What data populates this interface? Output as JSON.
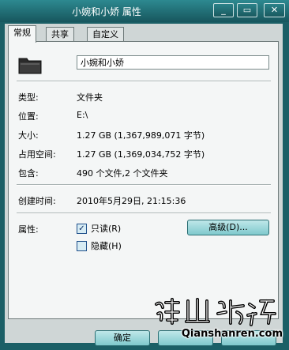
{
  "window": {
    "title": "小婉和小娇 属性",
    "buttons": {
      "minimize": "_",
      "maximize": "▭",
      "close": "✕"
    }
  },
  "tabs": [
    {
      "label": "常规",
      "active": true
    },
    {
      "label": "共享",
      "active": false
    },
    {
      "label": "自定义",
      "active": false
    }
  ],
  "general": {
    "folder_icon": "folder-icon",
    "name_value": "小婉和小娇",
    "rows": [
      {
        "label": "类型:",
        "value": "文件夹"
      },
      {
        "label": "位置:",
        "value": "E:\\"
      },
      {
        "label": "大小:",
        "value": "1.27 GB (1,367,989,071 字节)"
      },
      {
        "label": "占用空间:",
        "value": "1.27 GB (1,369,034,752 字节)"
      },
      {
        "label": "包含:",
        "value": "490 个文件,2 个文件夹"
      }
    ],
    "created": {
      "label": "创建时间:",
      "value": "2010年5月29日, 21:15:36"
    },
    "attributes": {
      "label": "属性:",
      "readonly": {
        "label": "只读(R)",
        "checked": true
      },
      "hidden": {
        "label": "隐藏(H)",
        "checked": false
      },
      "advanced_button": "高级(D)..."
    }
  },
  "footer": {
    "ok": "确定",
    "cancel": "",
    "apply": ""
  },
  "watermark": {
    "url": "Qianshanren.com"
  },
  "colors": {
    "titlebar": "#1b5f66",
    "panel": "#f4f6f6",
    "button": "#9fd8db"
  }
}
